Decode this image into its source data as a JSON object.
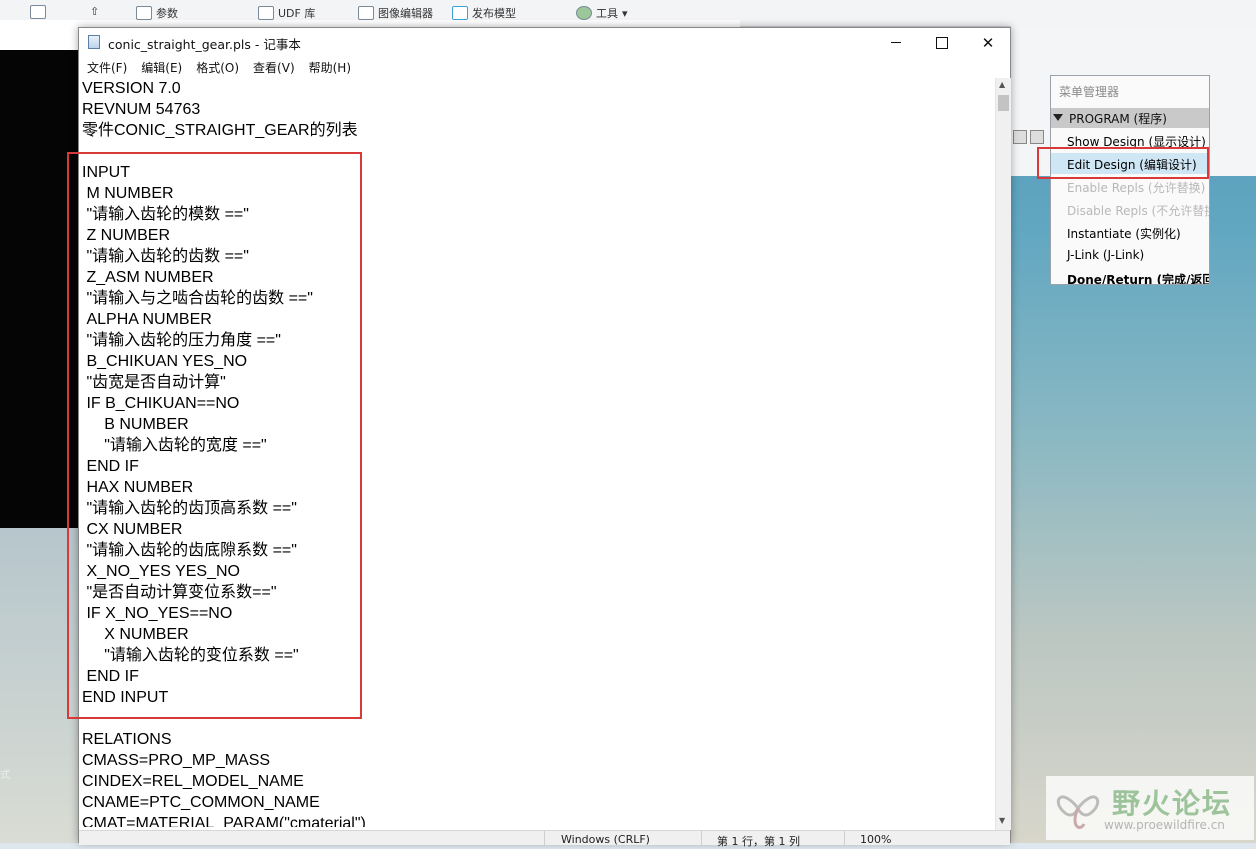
{
  "background_app": {
    "toolbar_items": [
      {
        "label": "参数",
        "icon": "parameters-icon"
      },
      {
        "label": "UDF 库",
        "icon": "udf-library-icon"
      },
      {
        "label": "图像编辑器",
        "icon": "image-editor-icon"
      },
      {
        "label": "发布模型",
        "icon": "publish-model-icon"
      },
      {
        "label": "工具",
        "icon": "tools-icon"
      }
    ],
    "mode_label": "式"
  },
  "notepad": {
    "title": "conic_straight_gear.pls - 记事本",
    "menu": [
      "文件(F)",
      "编辑(E)",
      "格式(O)",
      "查看(V)",
      "帮助(H)"
    ],
    "content": "VERSION 7.0\nREVNUM 54763\n零件CONIC_STRAIGHT_GEAR的列表\n\nINPUT\n M NUMBER\n \"请输入齿轮的模数 ==\"\n Z NUMBER\n \"请输入齿轮的齿数 ==\"\n Z_ASM NUMBER\n \"请输入与之啮合齿轮的齿数 ==\"\n ALPHA NUMBER\n \"请输入齿轮的压力角度 ==\"\n B_CHIKUAN YES_NO\n \"齿宽是否自动计算\"\n IF B_CHIKUAN==NO\n     B NUMBER\n     \"请输入齿轮的宽度 ==\"\n END IF\n HAX NUMBER\n \"请输入齿轮的齿顶高系数 ==\"\n CX NUMBER\n \"请输入齿轮的齿底隙系数 ==\"\n X_NO_YES YES_NO\n \"是否自动计算变位系数==\"\n IF X_NO_YES==NO\n     X NUMBER\n     \"请输入齿轮的变位系数 ==\"\n END IF\nEND INPUT\n\nRELATIONS\nCMASS=PRO_MP_MASS\nCINDEX=REL_MODEL_NAME\nCNAME=PTC_COMMON_NAME\nCMAT=MATERIAL_PARAM(\"cmaterial\")",
    "status": {
      "encoding": "Windows (CRLF)",
      "position": "第 1 行，第 1 列",
      "zoom": "100%"
    }
  },
  "menu_manager": {
    "title": "菜单管理器",
    "header": "PROGRAM (程序)",
    "items": [
      {
        "label": "Show Design (显示设计)",
        "state": "normal"
      },
      {
        "label": "Edit Design (编辑设计)",
        "state": "selected"
      },
      {
        "label": "Enable Repls (允许替换)",
        "state": "disabled"
      },
      {
        "label": "Disable Repls (不允许替换)",
        "state": "disabled"
      },
      {
        "label": "Instantiate (实例化)",
        "state": "normal"
      },
      {
        "label": "J-Link (J-Link)",
        "state": "normal"
      },
      {
        "label": "Done/Return (完成/返回)",
        "state": "bold"
      }
    ]
  },
  "watermark": {
    "text": "野火论坛",
    "url": "www.proewildfire.cn"
  },
  "colors": {
    "highlight_box": "#d83a3a",
    "selected_item": "#cfe6f5"
  }
}
